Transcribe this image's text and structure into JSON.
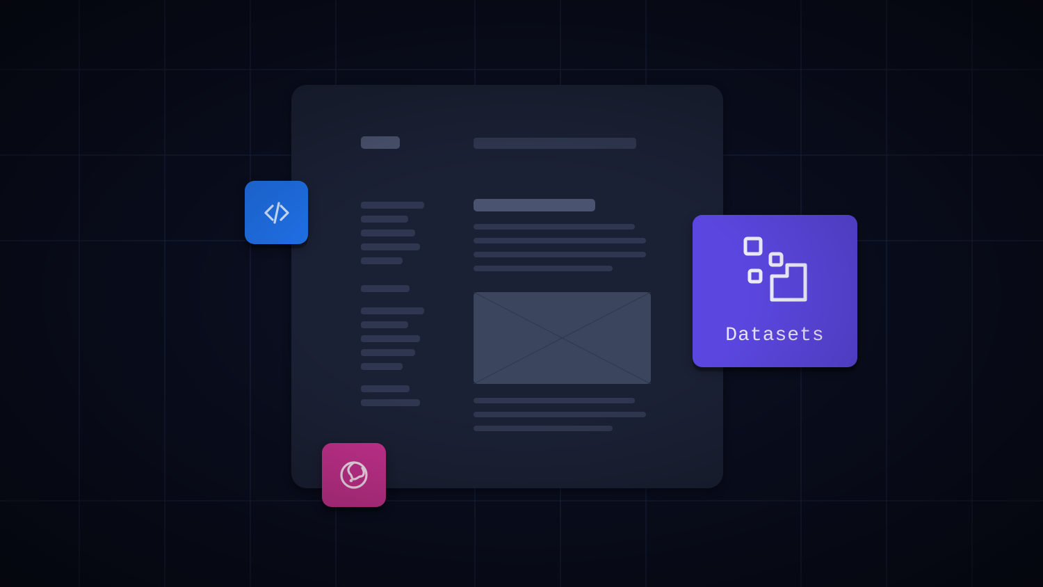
{
  "cards": {
    "datasets_label": "Datasets"
  },
  "icons": {
    "code": "code-icon",
    "datasets": "datasets-icon",
    "globe": "globe-icon"
  },
  "colors": {
    "background": "#0a0e1f",
    "document_bg": "#1b2135",
    "code_card": "#1f6fe5",
    "datasets_card": "#5b47e0",
    "globe_card": "#c6328f"
  }
}
